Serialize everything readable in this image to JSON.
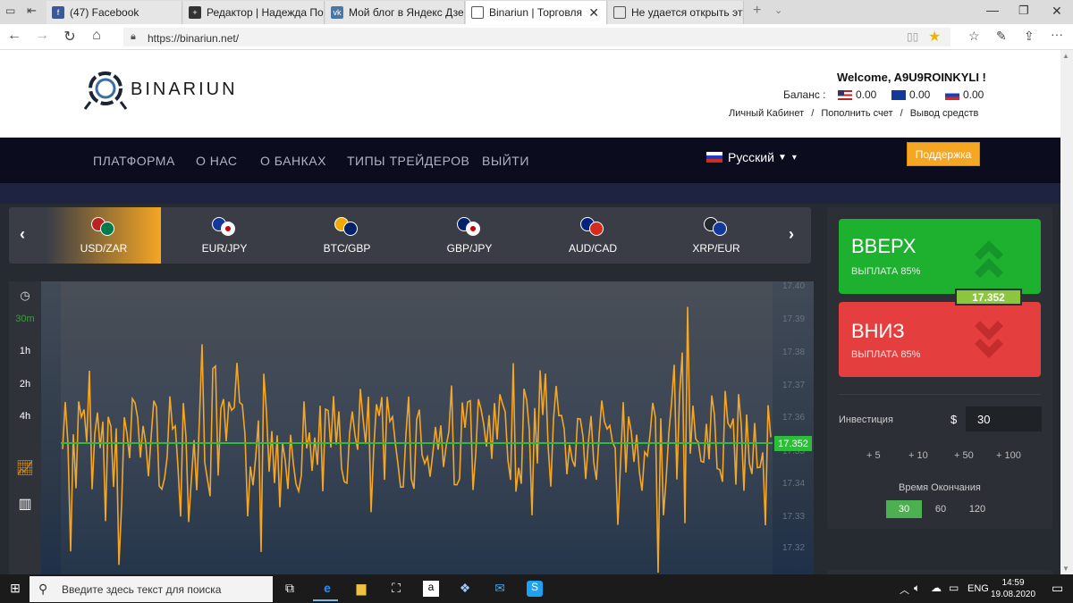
{
  "browser": {
    "tabs": [
      {
        "label": "(47) Facebook",
        "icon": "facebook-icon"
      },
      {
        "label": "Редактор | Надежда Попов",
        "icon": "plus-icon"
      },
      {
        "label": "Мой блог в Яндекс Дзен",
        "icon": "vk-icon"
      },
      {
        "label": "Binariun | Торговля",
        "icon": "page-icon"
      },
      {
        "label": "Не удается открыть эту стр",
        "icon": "page-icon"
      }
    ],
    "url": "https://binariun.net/"
  },
  "header": {
    "logo": "BINARIUN",
    "welcome": "Welcome, A9U9ROINKYLI !",
    "balance_label": "Баланс :",
    "balances": [
      "0.00",
      "0.00",
      "0.00"
    ],
    "links": [
      "Личный Кабинет",
      "Пополнить счет",
      "Вывод средств"
    ],
    "link_sep": "/"
  },
  "nav": {
    "items": [
      "ПЛАТФОРМА",
      "О НАС",
      "О БАНКАХ",
      "ТИПЫ ТРЕЙДЕРОВ",
      "ВЫЙТИ"
    ],
    "language": "Русский",
    "support": "Поддержка"
  },
  "assets": [
    "USD/ZAR",
    "EUR/JPY",
    "BTC/GBP",
    "GBP/JPY",
    "AUD/CAD",
    "XRP/EUR"
  ],
  "timeframes": [
    "30m",
    "1h",
    "2h",
    "4h"
  ],
  "chart": {
    "yticks": [
      "17.40",
      "17.39",
      "17.38",
      "17.37",
      "17.36",
      "17.35",
      "17.34",
      "17.33",
      "17.32"
    ],
    "current": "17.352",
    "line_color": "#f5a623",
    "level_color": "#2dbd3a"
  },
  "trade": {
    "up_label": "ВВЕРХ",
    "up_payout": "ВЫПЛАТА 85%",
    "down_label": "ВНИЗ",
    "down_payout": "ВЫПЛАТА 85%",
    "price": "17.352",
    "invest_label": "Инвестиция",
    "currency": "$",
    "invest_value": "30",
    "increments": [
      "+ 5",
      "+ 10",
      "+ 50",
      "+ 100"
    ],
    "expiry_label": "Время Окончания",
    "expiry_options": [
      "30",
      "60",
      "120"
    ]
  },
  "taskbar": {
    "search_placeholder": "Введите здесь текст для поиска",
    "lang": "ENG",
    "time": "14:59",
    "date": "19.08.2020"
  }
}
